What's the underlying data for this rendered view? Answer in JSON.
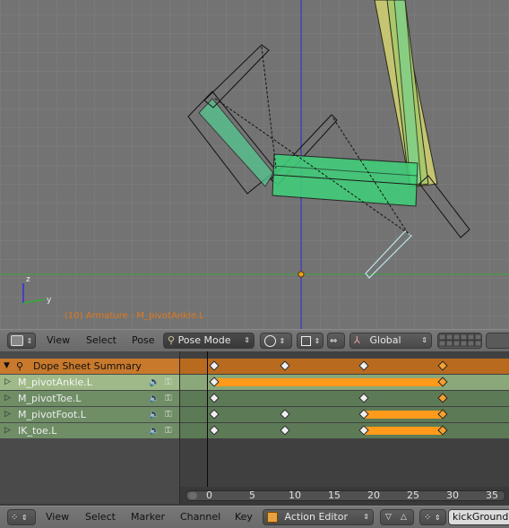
{
  "viewport": {
    "axis_z": "z",
    "axis_y": "y",
    "status_text": "(10) Armature : M_pivotAnkle.L"
  },
  "view3d_header": {
    "view_label": "View",
    "select_label": "Select",
    "pose_label": "Pose",
    "mode_label": "Pose Mode",
    "orientation_label": "Global",
    "icons": [
      "view3d-editor-icon",
      "pose-mode-icon",
      "viewport-shading-icon",
      "pivot-point-icon",
      "snap-icon",
      "transform-manipulator-icon"
    ]
  },
  "dopesheet": {
    "summary_label": "Dope Sheet Summary",
    "channels": [
      {
        "label": "M_pivotAnkle.L",
        "selected": true
      },
      {
        "label": "M_pivotToe.L",
        "selected": false
      },
      {
        "label": "M_pivotFoot.L",
        "selected": false
      },
      {
        "label": "IK_toe.L",
        "selected": false
      }
    ],
    "keyframes": {
      "summary": [
        0,
        9,
        19,
        29
      ],
      "M_pivotAnkle.L": [
        0,
        29
      ],
      "M_pivotToe.L": [
        0,
        19,
        29
      ],
      "M_pivotFoot.L": [
        0,
        9,
        19,
        29
      ],
      "IK_toe.L": [
        0,
        9,
        19,
        29
      ]
    },
    "holds": {
      "M_pivotAnkle.L": [
        [
          0,
          29
        ]
      ],
      "M_pivotFoot.L": [
        [
          19,
          29
        ]
      ],
      "IK_toe.L": [
        [
          19,
          29
        ]
      ]
    },
    "current_frame": 0,
    "ruler_ticks": [
      "0",
      "5",
      "10",
      "15",
      "20",
      "25",
      "30",
      "35"
    ],
    "colors": {
      "summary_bg": "#c8792c",
      "selected_channel_bg": "#9fba88",
      "channel_bg": "#6f8e66",
      "hold_bar": "#ff9a1a",
      "key_selected": "#f5a030",
      "key_unselected": "#f0f0f0"
    }
  },
  "bottom_header": {
    "view_label": "View",
    "select_label": "Select",
    "marker_label": "Marker",
    "channel_label": "Channel",
    "key_label": "Key",
    "mode_label": "Action Editor",
    "action_name": "kickGround"
  }
}
